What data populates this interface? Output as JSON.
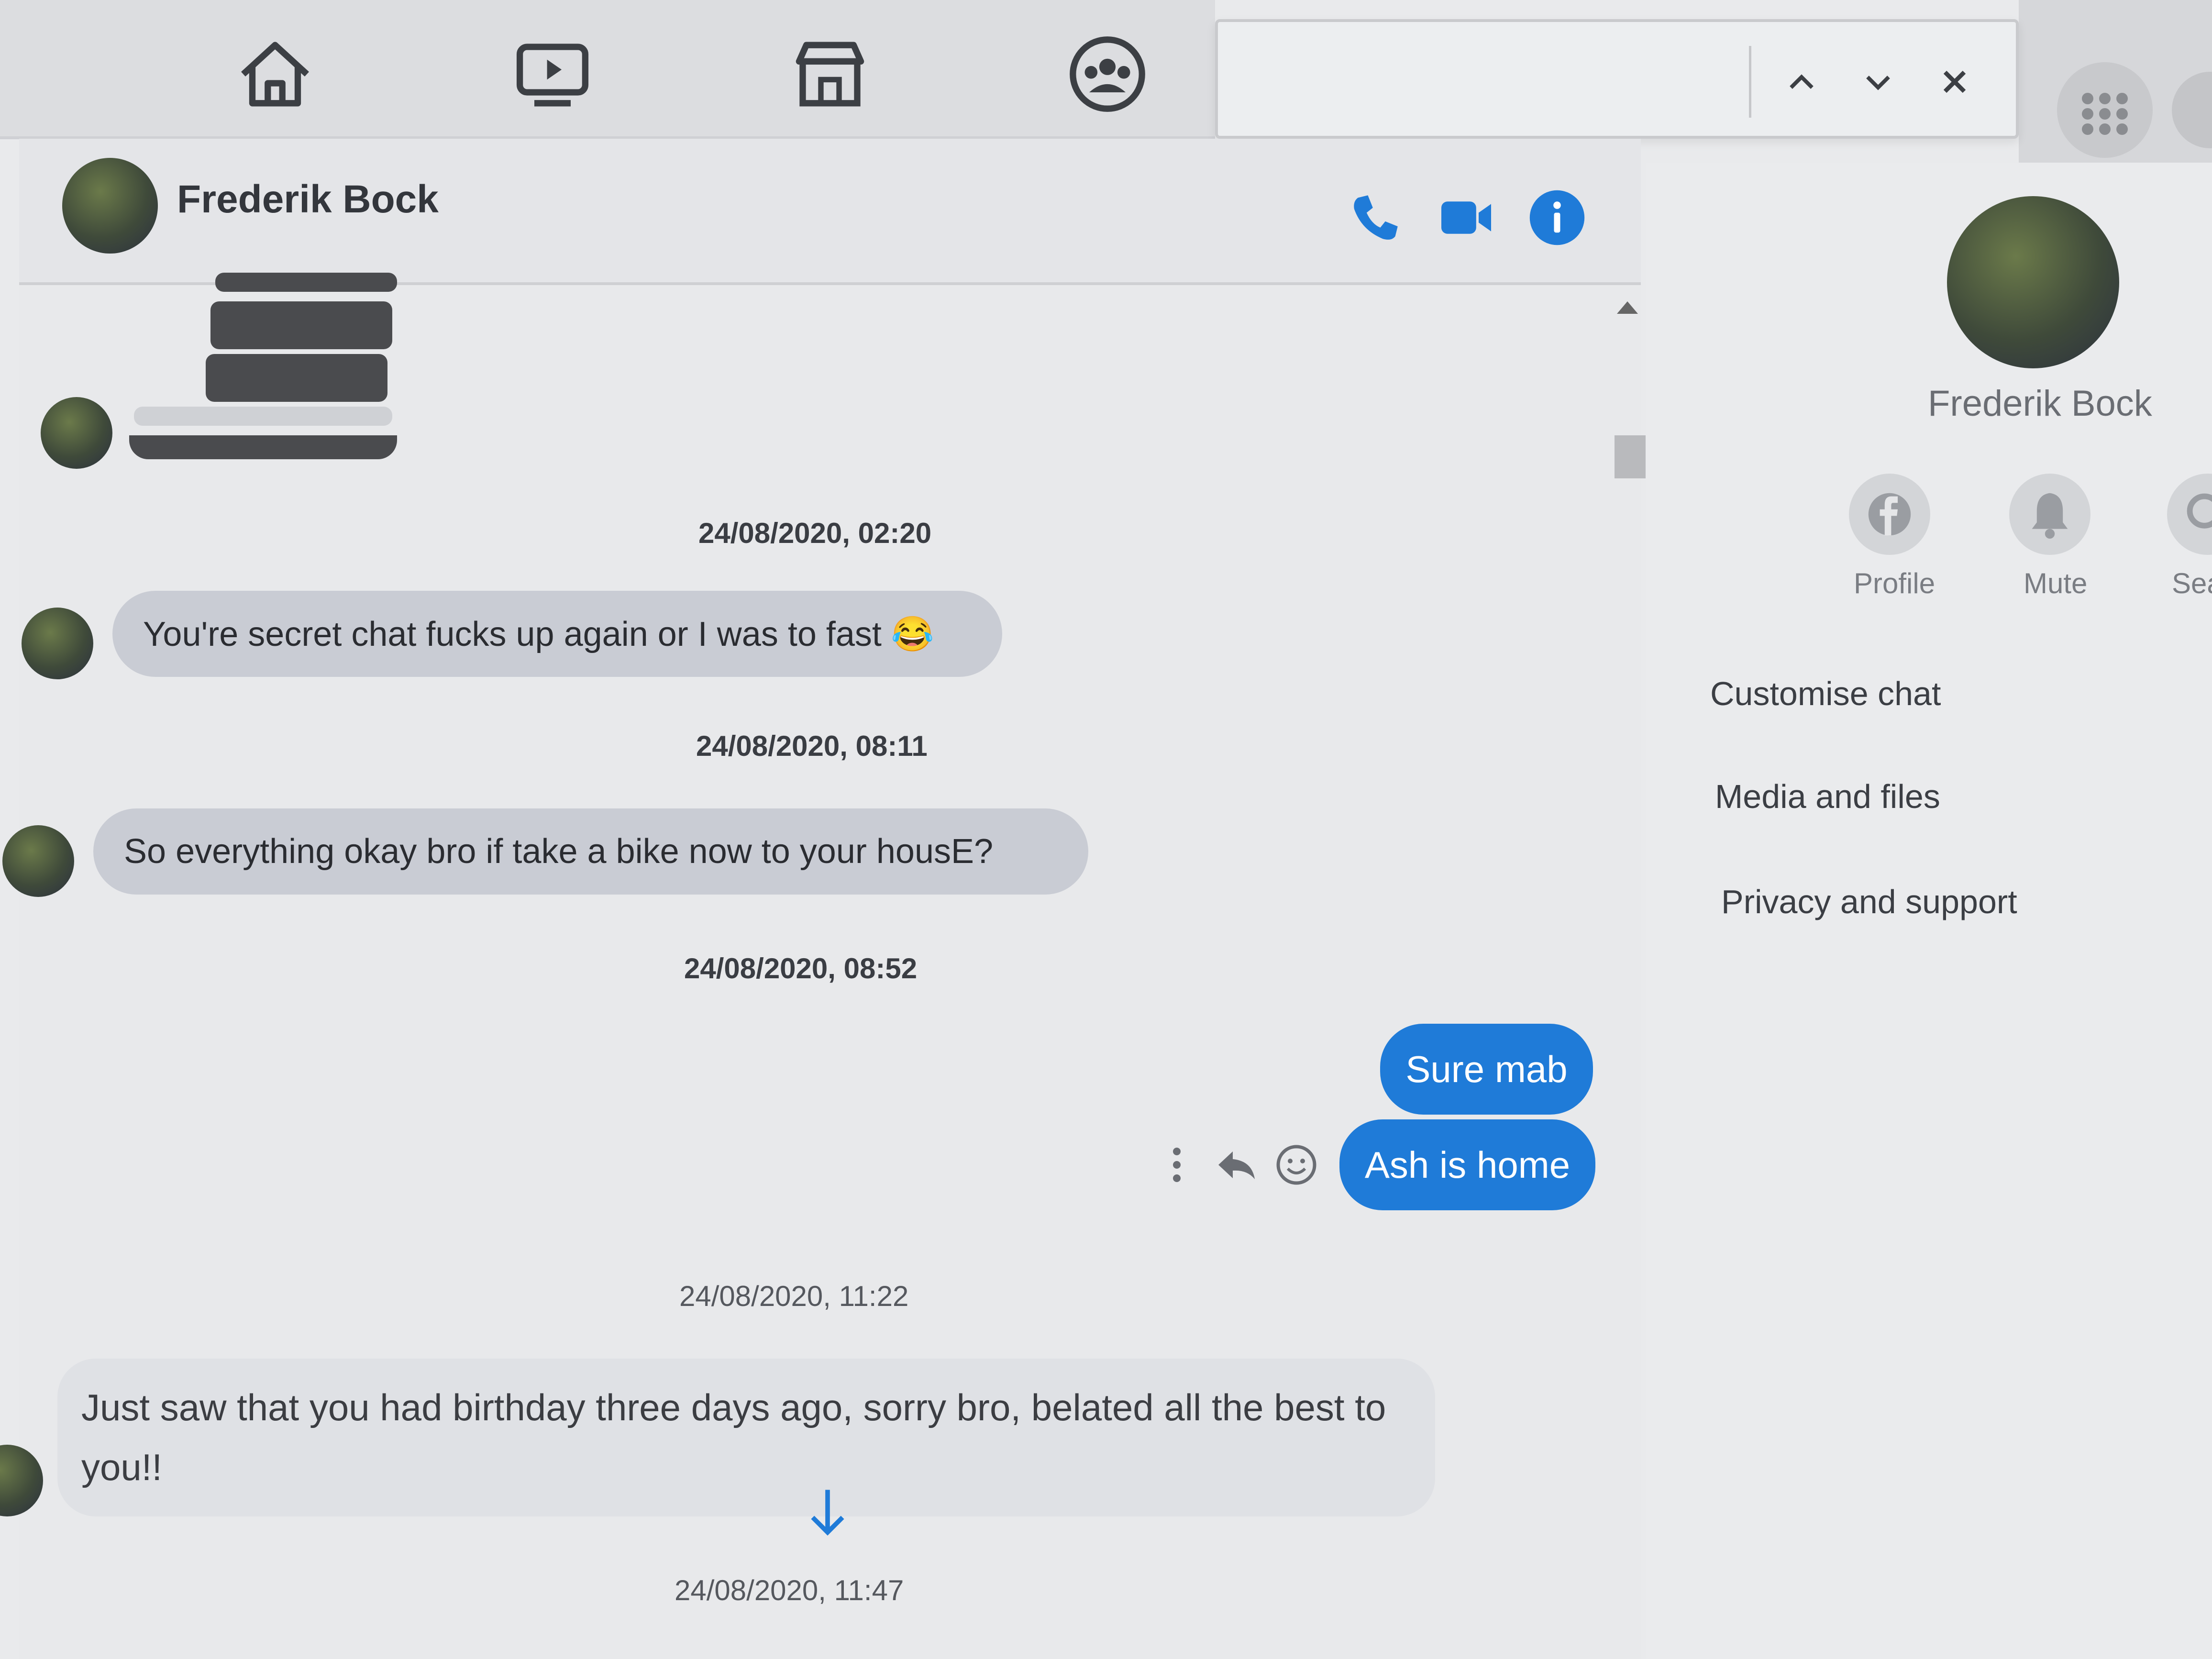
{
  "nav": {
    "icons": [
      "home-icon",
      "watch-icon",
      "marketplace-icon",
      "groups-icon"
    ]
  },
  "find_bar": {
    "value": "",
    "icons": [
      "chevron-up-icon",
      "chevron-down-icon",
      "close-icon"
    ]
  },
  "chat": {
    "contact_name": "Frederik Bock",
    "header_icons": [
      "phone-icon",
      "video-icon",
      "info-icon"
    ]
  },
  "messages": [
    {
      "type": "timestamp",
      "text": "24/08/2020, 02:20"
    },
    {
      "type": "incoming",
      "text": "You're secret chat fucks up again or I was to fast 😂"
    },
    {
      "type": "timestamp",
      "text": "24/08/2020, 08:11"
    },
    {
      "type": "incoming",
      "text": "So everything okay bro if take a bike now to your housE?"
    },
    {
      "type": "timestamp",
      "text": "24/08/2020, 08:52"
    },
    {
      "type": "outgoing",
      "text": "Sure mab"
    },
    {
      "type": "outgoing",
      "text": "Ash is home"
    },
    {
      "type": "timestamp",
      "text": "24/08/2020, 11:22"
    },
    {
      "type": "incoming",
      "text": "Just saw that you had birthday three days ago, sorry bro, belated all the best to you!!"
    },
    {
      "type": "timestamp",
      "text": "24/08/2020, 11:47"
    }
  ],
  "message_actions": [
    "more-icon",
    "reply-icon",
    "react-icon"
  ],
  "info_panel": {
    "name": "Frederik Bock",
    "actions": [
      {
        "label": "Profile",
        "icon": "facebook-icon"
      },
      {
        "label": "Mute",
        "icon": "bell-icon"
      },
      {
        "label": "Sea",
        "icon": "search-icon"
      }
    ],
    "menu": [
      "Customise chat",
      "Media and files",
      "Privacy and support"
    ]
  },
  "colors": {
    "accent": "#1f7bd8",
    "incoming_bubble": "#c9ccd4",
    "background": "#e8e9eb"
  }
}
